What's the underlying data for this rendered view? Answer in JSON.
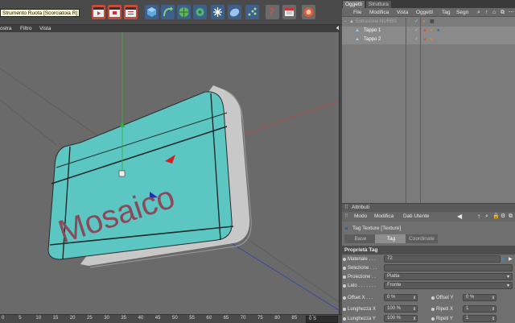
{
  "toolbar": {
    "tooltip": "Strumento Ruota [Scorciatoia R]",
    "buttons": [
      "play-clapper-icon",
      "record-clapper-icon",
      "render-clapper-icon",
      "cube-icon",
      "bend-arrow-icon",
      "sphere-grid-icon",
      "gear-object-icon",
      "snowflake-icon",
      "camera-icon",
      "particles-icon",
      "question-icon",
      "calendar-icon",
      "render-settings-icon"
    ]
  },
  "viewport": {
    "menu": {
      "view": "ostra",
      "filter": "Filtro",
      "view2": "Vista"
    },
    "object_text": "Mosaico",
    "colors": {
      "background": "#6a6a6a",
      "mesh": "#5cc6c3",
      "text": "#8a4a5a"
    }
  },
  "timeline": {
    "ticks": [
      "0",
      "5",
      "10",
      "15",
      "20",
      "25",
      "30",
      "35",
      "40",
      "45",
      "50",
      "55",
      "60",
      "65",
      "70",
      "75",
      "80",
      "85",
      "90"
    ],
    "frame": "0 S"
  },
  "objects_panel": {
    "tabs": [
      "Oggetti",
      "Struttura"
    ],
    "menu": [
      "File",
      "Modifica",
      "Vista",
      "Oggetti",
      "Tag",
      "Segn"
    ],
    "rows": [
      {
        "name": "Estrusione NURBS",
        "indent": 0
      },
      {
        "name": "Tappo 1",
        "indent": 1
      },
      {
        "name": "Tappo 2",
        "indent": 1
      }
    ]
  },
  "attributes_panel": {
    "title": "Attributi",
    "menu": [
      "Modo",
      "Modifica",
      "Dati Utente"
    ],
    "tag_title": "Tag Texture [Texture]",
    "subtabs": [
      "Base",
      "Tag",
      "Coordinate"
    ],
    "section": "Proprietà Tag",
    "props": {
      "materiale_label": "Materiale . . .",
      "materiale_value": "72",
      "selezione_label": "Selezione . . .",
      "selezione_value": "",
      "proiezione_label": "Proiezione . .",
      "proiezione_value": "Piatta",
      "lato_label": "Lato . . . . . . .",
      "lato_value": "Fronte",
      "offset_x_label": "Offset X . . .",
      "offset_x_value": "0 %",
      "offset_y_label": "Offset Y",
      "offset_y_value": "0 %",
      "lunghezza_x_label": "Lunghezza X",
      "lunghezza_x_value": "100 %",
      "ripeti_x_label": "Ripeti X",
      "ripeti_x_value": "1",
      "lunghezza_y_label": "Lunghezza Y",
      "lunghezza_y_value": "100 %",
      "ripeti_y_label": "Ripeti Y",
      "ripeti_y_value": "1"
    }
  }
}
